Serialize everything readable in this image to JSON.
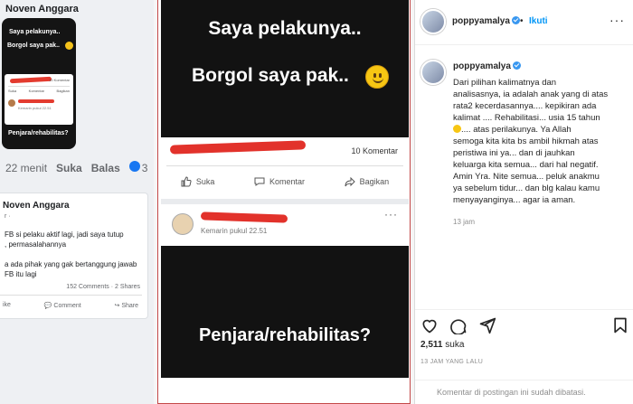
{
  "left": {
    "story_author": "Noven Anggara",
    "mini_story": {
      "line1": "Saya pelakunya..",
      "line2": "Borgol saya pak..",
      "komentar": "10 Komentar",
      "like": "Suka",
      "comment": "Komentar",
      "share": "Bagikan",
      "kemarin": "Kemarin pukul 22.51",
      "line3": "Penjara/rehabilitas?"
    },
    "meta": {
      "time": "22 menit",
      "like": "Suka",
      "reply": "Balas",
      "count": "3"
    },
    "post": {
      "author": "Noven Anggara",
      "sub": "r ·",
      "text": "FB si pelaku aktif lagi, jadi saya tutup\n, permasalahannya\n\na ada pihak yang gak bertanggung jawab\nFB itu lagi",
      "counts": "152 Comments · 2 Shares",
      "like": "ike",
      "comment": "Comment",
      "share": "Share"
    }
  },
  "middle": {
    "story1_line1": "Saya pelakunya..",
    "story1_line2": "Borgol saya pak..",
    "komentar_count": "10 Komentar",
    "actions": {
      "like": "Suka",
      "comment": "Komentar",
      "share": "Bagikan"
    },
    "post2_time": "Kemarin pukul 22.51",
    "story2_text": "Penjara/rehabilitas?"
  },
  "instagram": {
    "username": "poppyamalya",
    "follow_sep": "•",
    "follow": "Ikuti",
    "more": "···",
    "caption_user": "poppyamalya",
    "caption_part1": "Dari pilihan kalimatnya dan\nanalisasnya, ia adalah anak yang di atas\nrata2 kecerdasannya.... kepikiran ada\nkalimat .... Rehabilitasi... usia 15 tahun\n",
    "caption_part2": ".... atas perilakunya. Ya Allah\nsemoga kita kita bs ambil hikmah atas\nperistiwa ini ya... dan di jauhkan\nkeluarga kita semua... dari hal negatif.\nAmin Yra. Nite semua... peluk anakmu\nya sebelum tidur... dan blg kalau kamu\nmenyayanginya... agar ia aman.",
    "caption_time": "13 jam",
    "likes_count": "2,511",
    "likes_label": "suka",
    "ago": "13 JAM YANG LALU",
    "comments_closed": "Komentar di postingan ini sudah dibatasi.",
    "icons": [
      "heart-icon",
      "comment-icon",
      "share-icon",
      "bookmark-icon"
    ],
    "accent": "#0095f6"
  }
}
